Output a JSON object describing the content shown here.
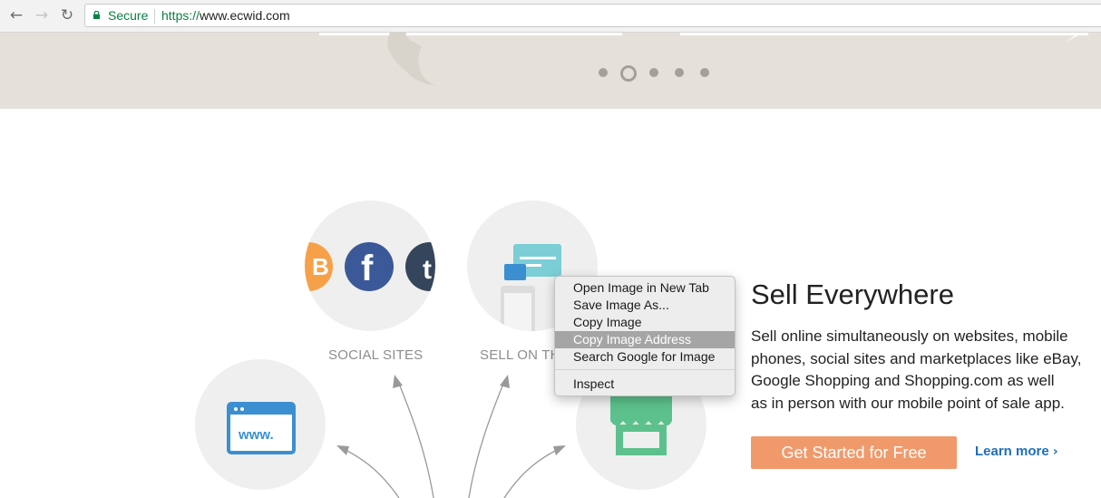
{
  "browser": {
    "back_icon": "arrow-left-icon",
    "forward_icon": "arrow-right-icon",
    "reload_icon": "reload-icon",
    "secure_label": "Secure",
    "url_scheme": "https://",
    "url_host": "www.ecwid.com"
  },
  "slider": {
    "dots": 5,
    "active_index": 1
  },
  "channels": [
    {
      "label": "SOCIAL SITES",
      "icons": [
        "blogger-icon",
        "facebook-icon",
        "tumblr-icon"
      ]
    },
    {
      "label": "SELL ON TH",
      "icons": [
        "mobile-devices-icon"
      ]
    },
    {
      "label": "",
      "icons": [
        "www-browser-icon"
      ]
    },
    {
      "label": "",
      "icons": [
        "storefront-icon"
      ]
    }
  ],
  "social_letters": {
    "facebook": "f",
    "tumblr": "t",
    "blogger": "B",
    "www": "www."
  },
  "content": {
    "headline": "Sell Everywhere",
    "description_lines": [
      "Sell online simultaneously on websites, mobile",
      "phones, social sites and marketplaces like eBay,",
      "Google Shopping and Shopping.com as well",
      "as in person with our mobile point of sale app."
    ],
    "cta_label": "Get Started for Free",
    "learn_more_label": "Learn more",
    "learn_more_icon": "chevron-right-icon"
  },
  "context_menu": {
    "items": [
      {
        "label": "Open Image in New Tab"
      },
      {
        "label": "Save Image As..."
      },
      {
        "label": "Copy Image"
      },
      {
        "label": "Copy Image Address",
        "highlighted": true
      },
      {
        "label": "Search Google for Image"
      }
    ],
    "footer_item": {
      "label": "Inspect"
    }
  },
  "colors": {
    "secure_green": "#0b8043",
    "hero_bg": "#e5e1da",
    "cta_bg": "#f09a6c",
    "link_blue": "#1e6fb8",
    "facebook_blue": "#3b5998",
    "tumblr_navy": "#35465c",
    "blogger_orange": "#f57d00",
    "teal": "#7bcdd6",
    "store_green": "#5cc18c",
    "www_blue": "#3b8fd0"
  }
}
